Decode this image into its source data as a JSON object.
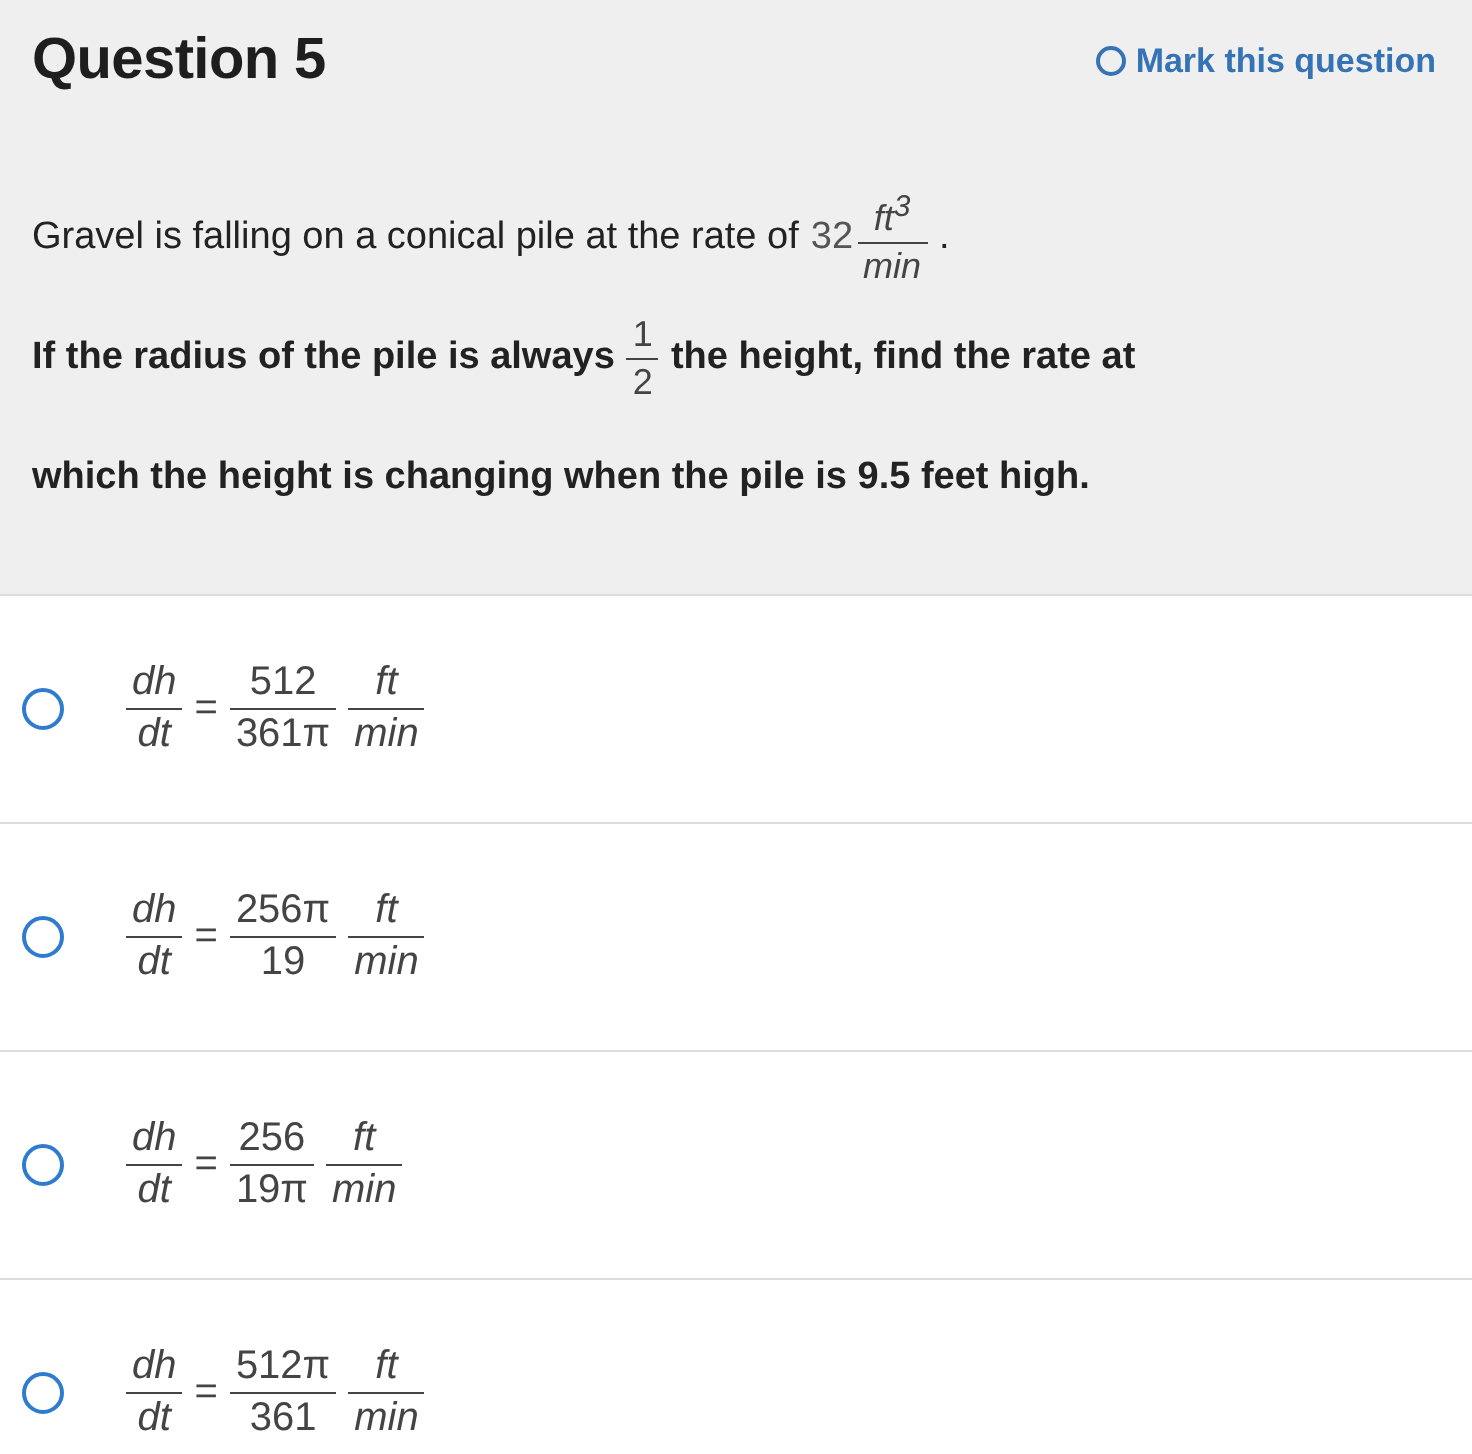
{
  "question": {
    "title": "Question 5",
    "mark": {
      "label": "Mark this question",
      "checked": false
    },
    "paragraphs": [
      {
        "bold": false,
        "parts": [
          {
            "kind": "text",
            "text": "Gravel is falling on a conical pile at the rate of"
          },
          {
            "kind": "number",
            "text": "32"
          },
          {
            "kind": "frac",
            "num": "ft$^{3}$",
            "den": "min",
            "italic": true
          },
          {
            "kind": "text",
            "text": "."
          }
        ]
      },
      {
        "bold": true,
        "parts": [
          {
            "kind": "text",
            "text": "If the radius of the pile is always"
          },
          {
            "kind": "frac",
            "num": "1",
            "den": "2",
            "italic": false
          },
          {
            "kind": "text",
            "text": "the height, find the rate at"
          }
        ]
      },
      {
        "bold": true,
        "parts": [
          {
            "kind": "text",
            "text": "which the height is changing when the pile is 9.5 feet high."
          }
        ]
      }
    ]
  },
  "options": [
    {
      "selected": false,
      "lhs": {
        "num": "dh",
        "den": "dt"
      },
      "eq": "=",
      "value": {
        "num": "512",
        "den": "361π"
      },
      "unit": {
        "num": "ft",
        "den": "min"
      }
    },
    {
      "selected": false,
      "lhs": {
        "num": "dh",
        "den": "dt"
      },
      "eq": "=",
      "value": {
        "num": "256π",
        "den": "19"
      },
      "unit": {
        "num": "ft",
        "den": "min"
      }
    },
    {
      "selected": false,
      "lhs": {
        "num": "dh",
        "den": "dt"
      },
      "eq": "=",
      "value": {
        "num": "256",
        "den": "19π"
      },
      "unit": {
        "num": "ft",
        "den": "min"
      }
    },
    {
      "selected": false,
      "lhs": {
        "num": "dh",
        "den": "dt"
      },
      "eq": "=",
      "value": {
        "num": "512π",
        "den": "361"
      },
      "unit": {
        "num": "ft",
        "den": "min"
      }
    }
  ]
}
